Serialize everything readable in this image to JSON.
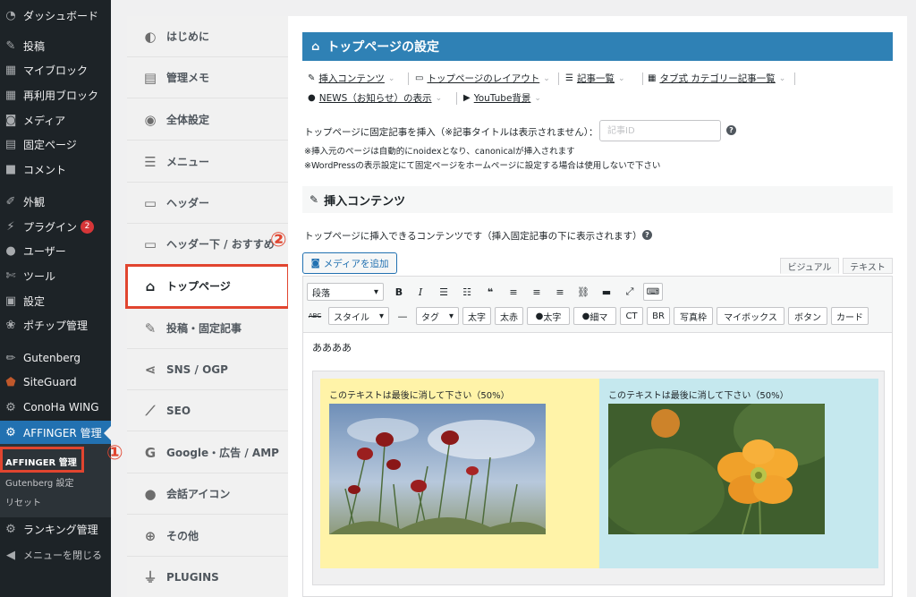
{
  "wp_sidebar": {
    "items": [
      {
        "label": "ダッシュボード",
        "icon": "dashboard-icon"
      },
      {
        "label": "投稿",
        "icon": "pin-icon"
      },
      {
        "label": "マイブロック",
        "icon": "grid-icon"
      },
      {
        "label": "再利用ブロック",
        "icon": "grid-icon"
      },
      {
        "label": "メディア",
        "icon": "media-icon"
      },
      {
        "label": "固定ページ",
        "icon": "page-icon"
      },
      {
        "label": "コメント",
        "icon": "comment-icon"
      },
      {
        "label": "外観",
        "icon": "brush-icon"
      },
      {
        "label": "プラグイン",
        "icon": "plugin-icon",
        "badge": "2"
      },
      {
        "label": "ユーザー",
        "icon": "user-icon"
      },
      {
        "label": "ツール",
        "icon": "wrench-icon"
      },
      {
        "label": "設定",
        "icon": "settings-icon"
      },
      {
        "label": "ポチップ管理",
        "icon": "paw-icon"
      },
      {
        "label": "Gutenberg",
        "icon": "pencil-icon"
      },
      {
        "label": "SiteGuard",
        "icon": "shield-icon"
      },
      {
        "label": "ConoHa WING",
        "icon": "gear-icon"
      },
      {
        "label": "AFFINGER 管理",
        "icon": "gear-icon"
      },
      {
        "label": "ランキング管理",
        "icon": "gear-icon"
      },
      {
        "label": "メニューを閉じる",
        "icon": "collapse-icon"
      }
    ],
    "submenu": [
      "AFFINGER 管理",
      "Gutenberg 設定",
      "リセット"
    ]
  },
  "annotations": {
    "one": "①",
    "two": "②"
  },
  "affinger_nav": [
    {
      "label": "はじめに",
      "icon": "shield-half-icon"
    },
    {
      "label": "管理メモ",
      "icon": "document-icon"
    },
    {
      "label": "全体設定",
      "icon": "palette-icon"
    },
    {
      "label": "メニュー",
      "icon": "menu-icon"
    },
    {
      "label": "ヘッダー",
      "icon": "header-icon"
    },
    {
      "label": "ヘッダー下 / おすすめ",
      "icon": "header-below-icon"
    },
    {
      "label": "トップページ",
      "icon": "home-icon"
    },
    {
      "label": "投稿・固定記事",
      "icon": "edit-icon"
    },
    {
      "label": "SNS / OGP",
      "icon": "share-icon"
    },
    {
      "label": "SEO",
      "icon": "chart-line-icon"
    },
    {
      "label": "Google・広告 / AMP",
      "icon": "google-icon"
    },
    {
      "label": "会話アイコン",
      "icon": "speech-bubble-icon"
    },
    {
      "label": "その他",
      "icon": "plus-circle-icon"
    },
    {
      "label": "PLUGINS",
      "icon": "plug-icon"
    }
  ],
  "main": {
    "title": "トップページの設定",
    "tabs_row1": [
      {
        "label": "挿入コンテンツ",
        "icon": "edit-icon"
      },
      {
        "label": "トップページのレイアウト",
        "icon": "layout-icon"
      },
      {
        "label": "記事一覧",
        "icon": "list-icon"
      },
      {
        "label": "タブ式 カテゴリー記事一覧",
        "icon": "grid-icon"
      }
    ],
    "tabs_row2": [
      {
        "label": "NEWS（お知らせ）の表示",
        "icon": "info-icon"
      },
      {
        "label": "YouTube背景",
        "icon": "youtube-icon"
      }
    ],
    "fixed_post_label": "トップページに固定記事を挿入（※記事タイトルは表示されません）：",
    "fixed_post_placeholder": "記事ID",
    "help": "?",
    "notes": [
      "※挿入元のページは自動的にnoidexとなり、canonicalが挿入されます",
      "※WordPressの表示設定にて固定ページをホームページに設定する場合は使用しないで下さい"
    ],
    "section_title": "挿入コンテンツ",
    "section_desc": "トップページに挿入できるコンテンツです（挿入固定記事の下に表示されます）",
    "add_media": "メディアを追加",
    "mode_visual": "ビジュアル",
    "mode_text": "テキスト",
    "toolbar": {
      "format_select": "段落",
      "style_select": "スタイル",
      "tag_select": "タグ",
      "buttons": [
        "太字",
        "太赤",
        "太字",
        "細マ",
        "CT",
        "BR",
        "写真枠",
        "マイボックス",
        "ボタン",
        "カード"
      ]
    },
    "editor_text": "ああああ",
    "columns": [
      {
        "caption": "このテキストは最後に消して下さい（50%）",
        "bg": "#fff3a8"
      },
      {
        "caption": "このテキストは最後に消して下さい（50%）",
        "bg": "#c5e8ee"
      }
    ]
  },
  "colors": {
    "accent": "#2f81b5",
    "wp_active": "#2271b1",
    "annotation": "#e1452f"
  }
}
